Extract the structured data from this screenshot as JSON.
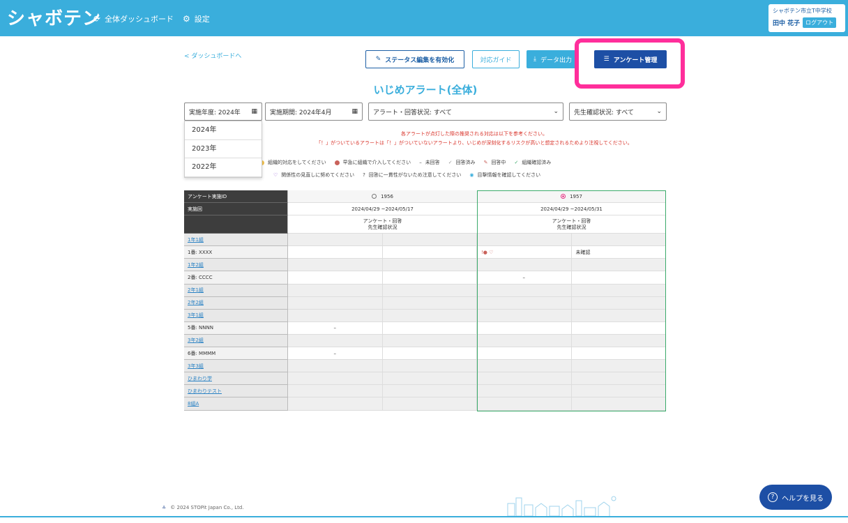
{
  "header": {
    "logo": "シャボテン",
    "nav": [
      {
        "icon": "refresh-icon",
        "label": "全体ダッシュボード"
      },
      {
        "icon": "gear-icon",
        "label": "設定"
      }
    ],
    "school": "シャボテン市立T中学校",
    "user_name": "田中 花子",
    "logout": "ログアウト"
  },
  "toolbar": {
    "back": "< ダッシュボードへ",
    "edit_status": "ステータス編集を有効化",
    "guide": "対応ガイド",
    "export": "データ出力",
    "survey_manage": "アンケート管理"
  },
  "page_title": "いじめアラート(全体)",
  "filters": {
    "year": "実施年度: 2024年",
    "period": "実施期間: 2024年4月",
    "alert": "アラート・回答状況: すべて",
    "teacher": "先生確認状況: すべて"
  },
  "year_options": [
    "2024年",
    "2023年",
    "2022年"
  ],
  "notes": [
    "各アラートが点灯した際の推奨される対応は以下を参考ください。",
    "「！」がついているアラートは「！」がついていないアラートより、いじめが深刻化するリスクが高いと想定されるためより注視してください。"
  ],
  "legend": {
    "row1": [
      {
        "icon": "yellow-dot",
        "label": "組織的対応をしてください"
      },
      {
        "icon": "red-dot",
        "label": "早急に組織で介入してください"
      },
      {
        "icon": "dash-icon",
        "label": "未回答"
      },
      {
        "icon": "check-gray-icon",
        "label": "回答済み"
      },
      {
        "icon": "pencil-icon",
        "label": "回答中"
      },
      {
        "icon": "check-green-icon",
        "label": "組織確認済み"
      }
    ],
    "row2": [
      {
        "icon": "heart-icon",
        "label": "関係性の見直しに努めてください"
      },
      {
        "icon": "question-icon",
        "label": "回答に一貫性がないため注意してください"
      },
      {
        "icon": "eye-icon",
        "label": "目撃情報を確認してください"
      }
    ]
  },
  "table": {
    "head_labels": [
      "アンケート実施ID",
      "実施回",
      ""
    ],
    "surveys": [
      {
        "id": "1956",
        "period": "2024/04/29 ~2024/05/17",
        "cols1": "アンケート・回答",
        "cols2": "先生確認状況"
      },
      {
        "id": "1957",
        "period": "2024/04/29 ~2024/05/31",
        "cols1": "アンケート・回答",
        "cols2": "先生確認状況"
      }
    ],
    "rows": [
      {
        "type": "class",
        "label": "1年1組"
      },
      {
        "type": "student",
        "label": "1番: XXXX",
        "s1": [
          "",
          ""
        ],
        "s2": [
          "!● ♡",
          "未確認"
        ]
      },
      {
        "type": "class",
        "label": "1年2組"
      },
      {
        "type": "student",
        "label": "2番: CCCC",
        "s1": [
          "",
          ""
        ],
        "s2": [
          "–",
          ""
        ]
      },
      {
        "type": "class",
        "label": "2年1組"
      },
      {
        "type": "class",
        "label": "2年2組"
      },
      {
        "type": "class",
        "label": "3年1組"
      },
      {
        "type": "student",
        "label": "5番: NNNN",
        "s1": [
          "–",
          ""
        ],
        "s2": [
          "",
          ""
        ]
      },
      {
        "type": "class",
        "label": "3年2組"
      },
      {
        "type": "student",
        "label": "6番: MMMM",
        "s1": [
          "–",
          ""
        ],
        "s2": [
          "",
          ""
        ]
      },
      {
        "type": "class",
        "label": "3年3組"
      },
      {
        "type": "class",
        "label": "ひまわり学"
      },
      {
        "type": "class",
        "label": "ひまわりテスト"
      },
      {
        "type": "class",
        "label": "8組A"
      }
    ]
  },
  "footer": {
    "copyright": "© 2024 STOPit Japan Co., Ltd."
  },
  "help": "ヘルプを見る",
  "colors": {
    "brand": "#3aaedc",
    "primary": "#1d4fa5",
    "highlight": "#ff2e9b",
    "alert_red": "#d9342b"
  }
}
